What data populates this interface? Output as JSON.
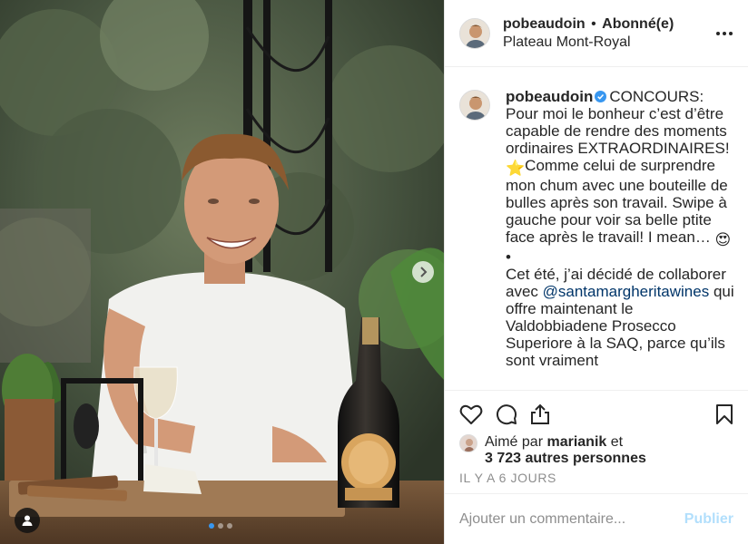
{
  "post": {
    "carousel": {
      "slide_count": 3,
      "active_index": 0
    }
  },
  "header": {
    "username": "pobeaudoin",
    "separator": "•",
    "follow_status": "Abonné(e)",
    "location": "Plateau Mont-Royal",
    "more_icon": "more-horizontal-icon"
  },
  "caption": {
    "username": "pobeaudoin",
    "verified_icon": "verified-badge-icon",
    "text_part1": "CONCOURS: Pour moi le bonheur c’est d’être capable de rendre des moments ordinaires EXTRAORDINAIRES!",
    "star_emoji": "⭐",
    "text_part2": "Comme celui de surprendre mon chum avec une bouteille de bulles après son travail. Swipe à gauche pour voir sa belle ptite face après le travail! I mean… ",
    "heart_eyes_emoji": "😍",
    "bullet": "•",
    "text_part3": "Cet été, j’ai décidé de collaborer avec ",
    "mention": "@santamargheritawines",
    "text_part4": " qui offre maintenant le Valdobbiadene Prosecco Superiore à la SAQ, parce qu’ils sont vraiment"
  },
  "actions": {
    "like_icon": "heart-icon",
    "comment_icon": "comment-icon",
    "share_icon": "share-icon",
    "save_icon": "bookmark-icon"
  },
  "likes": {
    "prefix": "Aimé par ",
    "liker": "marianik",
    "middle": " et",
    "others_count": "3 723 autres personnes"
  },
  "timestamp": "Il y a 6 jours",
  "comment": {
    "placeholder": "Ajouter un commentaire...",
    "publish_label": "Publier"
  },
  "colors": {
    "link": "#003569",
    "verified": "#3897f0",
    "publish_disabled": "#b2dffc",
    "muted": "#8e8e8e",
    "carousel_active": "#3897f0"
  }
}
